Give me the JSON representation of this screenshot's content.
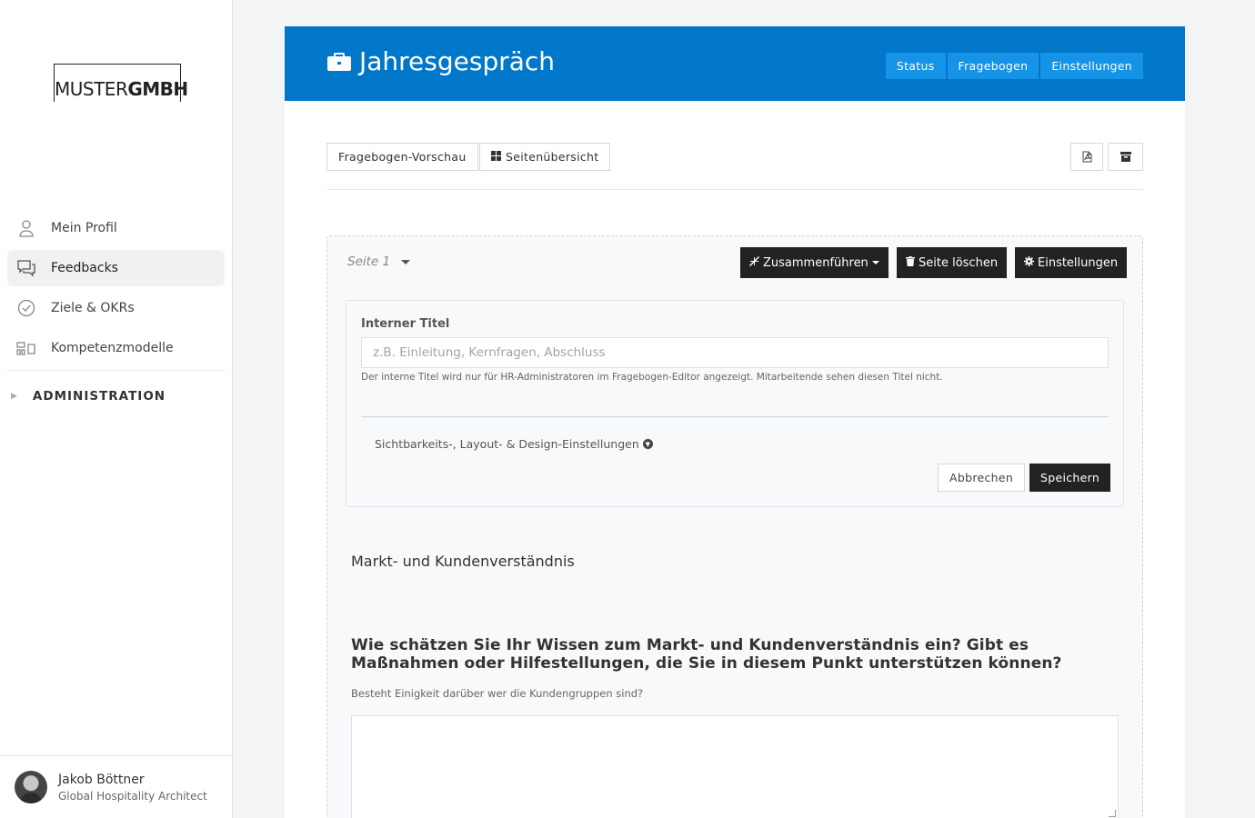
{
  "logo": {
    "part1": "MUSTER",
    "part2": "GMBH"
  },
  "sidebar": {
    "items": [
      {
        "label": "Mein Profil",
        "icon": "person-icon"
      },
      {
        "label": "Feedbacks",
        "icon": "chat-icon",
        "active": true
      },
      {
        "label": "Ziele & OKRs",
        "icon": "check-circle-icon"
      },
      {
        "label": "Kompetenzmodelle",
        "icon": "grid-icon"
      }
    ],
    "admin": "ADMINISTRATION"
  },
  "user": {
    "name": "Jakob Böttner",
    "role": "Global Hospitality Architect"
  },
  "header": {
    "title": "Jahresgespräch",
    "buttons": [
      "Status",
      "Fragebogen",
      "Einstellungen"
    ],
    "color": "#0077c8"
  },
  "toolbar": {
    "preview": "Fragebogen-Vorschau",
    "overview": "Seitenübersicht"
  },
  "page": {
    "label": "Seite 1",
    "merge": "Zusammenführen",
    "delete": "Seite löschen",
    "settings": "Einstellungen"
  },
  "form": {
    "label": "Interner Titel",
    "placeholder": "z.B. Einleitung, Kernfragen, Abschluss",
    "help": "Der interne Titel wird nur für HR-Administratoren im Fragebogen-Editor angezeigt. Mitarbeitende sehen diesen Titel nicht.",
    "visibility": "Sichtbarkeits-, Layout- & Design-Einstellungen",
    "cancel": "Abbrechen",
    "save": "Speichern"
  },
  "content": {
    "section": "Markt- und Kundenverständnis",
    "question": "Wie schätzen Sie Ihr Wissen zum Markt- und Kundenverständnis ein? Gibt es Maßnahmen oder Hilfestellungen, die Sie in diesem Punkt unterstützen können?",
    "hint": "Besteht Einigkeit darüber wer die Kundengruppen sind?"
  }
}
